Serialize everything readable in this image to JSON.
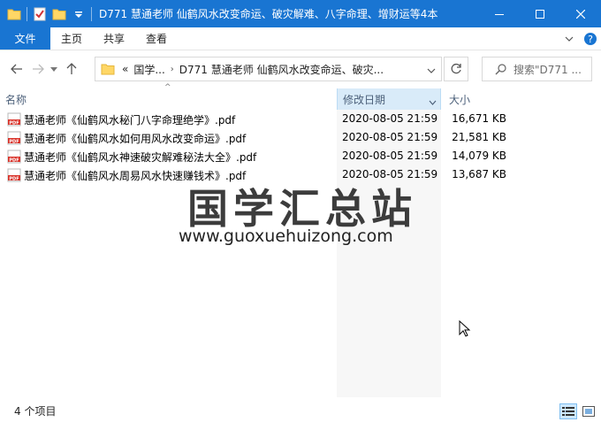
{
  "window": {
    "title": "D771 慧通老师 仙鹤风水改变命运、破灾解难、八字命理、增财运等4本",
    "accent": "#1975d2"
  },
  "ribbon": {
    "file_tab": "文件",
    "tabs": [
      "主页",
      "共享",
      "查看"
    ]
  },
  "address": {
    "overflow": "«",
    "crumbs": [
      "国学...",
      "D771 慧通老师 仙鹤风水改变命运、破灾..."
    ]
  },
  "search": {
    "placeholder": "搜索\"D771 ..."
  },
  "columns": {
    "name": "名称",
    "date": "修改日期",
    "size": "大小"
  },
  "files": [
    {
      "name": "慧通老师《仙鹤风水秘门八字命理绝学》.pdf",
      "date": "2020-08-05 21:59",
      "size": "16,671 KB"
    },
    {
      "name": "慧通老师《仙鹤风水如何用风水改变命运》.pdf",
      "date": "2020-08-05 21:59",
      "size": "21,581 KB"
    },
    {
      "name": "慧通老师《仙鹤风水神速破灾解难秘法大全》.pdf",
      "date": "2020-08-05 21:59",
      "size": "14,079 KB"
    },
    {
      "name": "慧通老师《仙鹤风水周易风水快速赚钱术》.pdf",
      "date": "2020-08-05 21:59",
      "size": "13,687 KB"
    }
  ],
  "watermark": {
    "title": "国学汇总站",
    "url": "www.guoxuehuizong.com"
  },
  "status": {
    "count": "4 个项目"
  },
  "icons": {
    "pdf": "pdf-file-icon",
    "folder": "folder-icon"
  }
}
